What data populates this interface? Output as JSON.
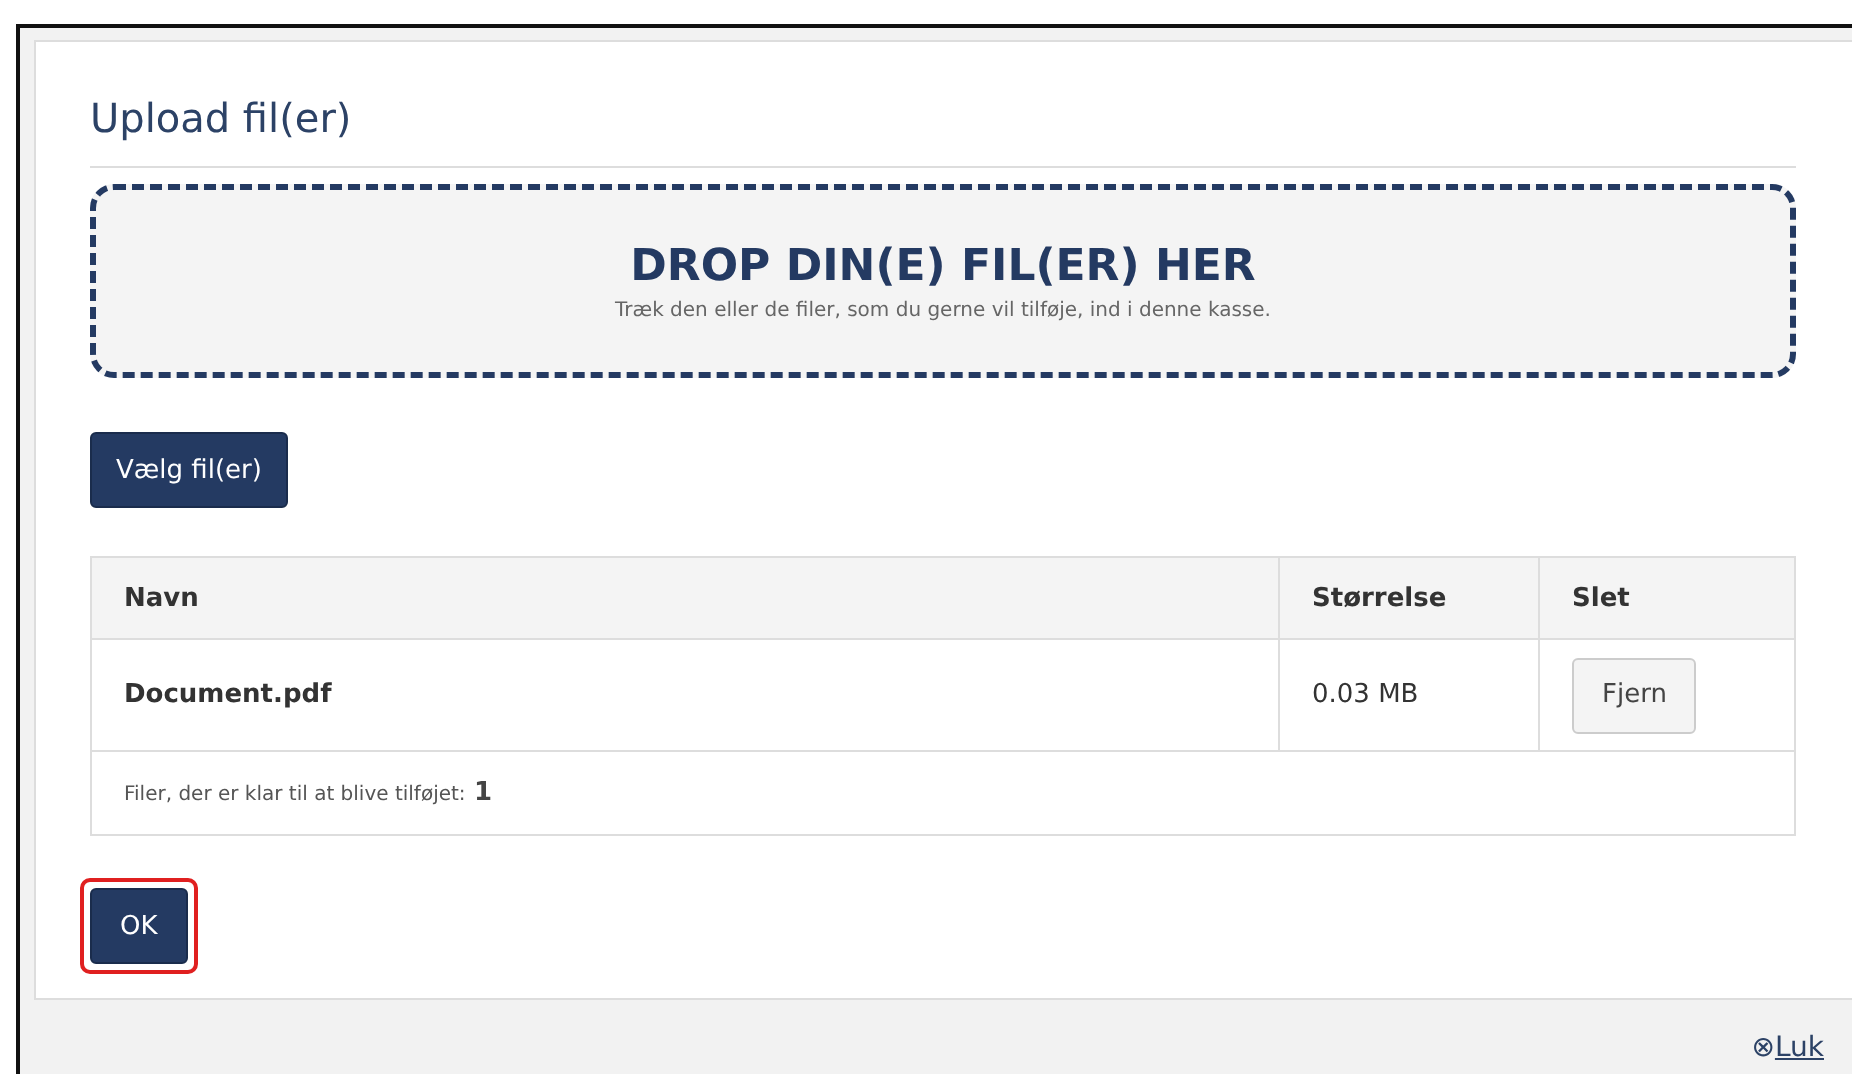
{
  "dialog": {
    "title": "Upload fil(er)",
    "dropzone": {
      "heading": "DROP DIN(E) FIL(ER) HER",
      "hint": "Træk den eller de filer, som du gerne vil tilføje, ind i denne kasse."
    },
    "choose_button": "Vælg fil(er)",
    "table": {
      "columns": [
        "Navn",
        "Størrelse",
        "Slet"
      ],
      "rows": [
        {
          "name": "Document.pdf",
          "size": "0.03 MB",
          "action": "Fjern"
        }
      ],
      "footer": {
        "label": "Filer, der er klar til at blive tilføjet:",
        "count": "1"
      }
    },
    "ok_button": {
      "label": "OK",
      "highlighted": true
    }
  },
  "close_link": {
    "icon": "⊗",
    "label": "Luk"
  }
}
